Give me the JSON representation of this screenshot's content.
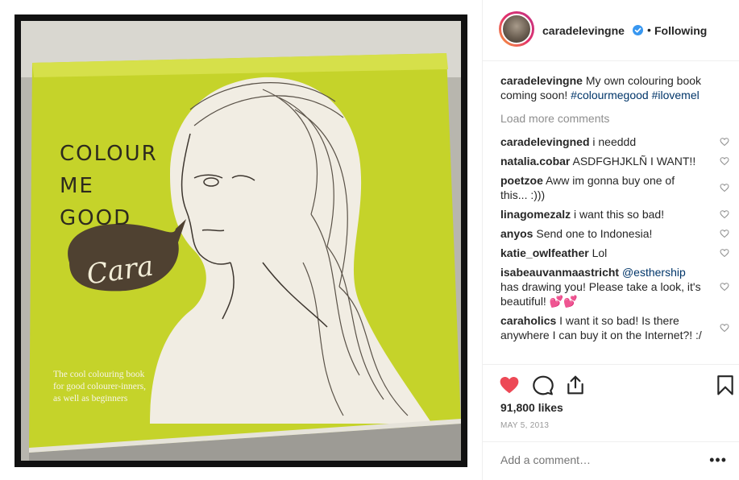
{
  "post": {
    "photo": {
      "alt": "Colouring book cover photo",
      "book_title": [
        "COLOUR",
        "ME",
        "GOOD"
      ],
      "book_author": "Cara",
      "book_blurb": "The cool colouring book for good colourer-inners, as well as beginners",
      "colors": {
        "cover": "#c9d62a",
        "speech_bubble": "#4f4131"
      }
    },
    "header": {
      "username": "caradelevingne",
      "verified": true,
      "separator": "•",
      "follow_status": "Following"
    },
    "caption": {
      "username": "caradelevingne",
      "text": "My own colouring book coming soon!",
      "tags": [
        "#colourmegood",
        "#ilovemel"
      ]
    },
    "load_more": "Load more comments",
    "comments": [
      {
        "user": "caradelevingned",
        "text": "i needdd"
      },
      {
        "user": "natalia.cobar",
        "text": "ASDFGHJKLÑ I WANT!!"
      },
      {
        "user": "poetzoe",
        "text": "Aww im gonna buy one of this... :)))"
      },
      {
        "user": "linagomezalz",
        "text": "i want this so bad!"
      },
      {
        "user": "anyos",
        "text": "Send one to Indonesia!"
      },
      {
        "user": "katie_owlfeather",
        "text": "Lol"
      },
      {
        "user": "isabeauvanmaastricht",
        "mention": "@esthership",
        "text": "has drawing you! Please take a look, it's beautiful! 💕💕"
      },
      {
        "user": "caraholics",
        "text": "I want it so bad! Is there anywhere I can buy it on the Internet?! :/"
      }
    ],
    "likes": "91,800 likes",
    "date": "MAY 5, 2013",
    "add_comment_placeholder": "Add a comment…",
    "more_label": "•••",
    "icons": {
      "like": "heart-filled-icon",
      "comment": "comment-bubble-icon",
      "share": "share-icon",
      "save": "bookmark-icon",
      "verified": "verified-badge-icon",
      "comment_like": "heart-outline-icon"
    },
    "colors": {
      "heart": "#ed4956",
      "verified": "#3897f0",
      "hashtag": "#003569"
    }
  }
}
